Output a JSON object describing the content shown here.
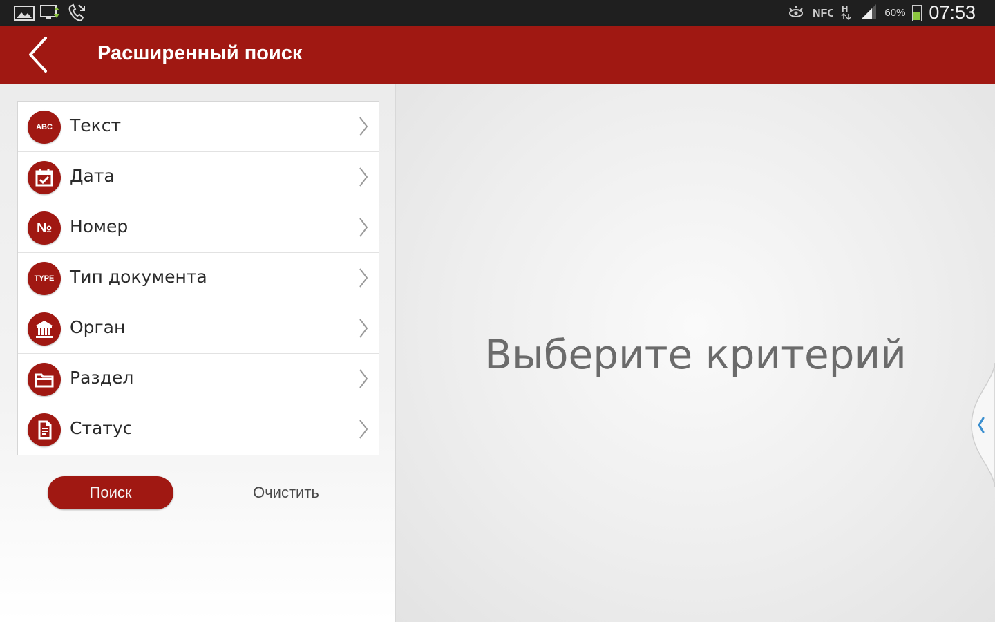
{
  "status_bar": {
    "battery_percent": "60%",
    "battery_level": 0.6,
    "time": "07:53"
  },
  "appbar": {
    "title": "Расширенный поиск"
  },
  "criteria": [
    {
      "label": "Текст",
      "icon": "abc-icon",
      "badge": "ABC"
    },
    {
      "label": "Дата",
      "icon": "calendar-icon"
    },
    {
      "label": "Номер",
      "icon": "number-icon",
      "badge": "№"
    },
    {
      "label": "Тип документа",
      "icon": "type-icon",
      "badge": "TYPE"
    },
    {
      "label": "Орган",
      "icon": "building-icon"
    },
    {
      "label": "Раздел",
      "icon": "folder-icon"
    },
    {
      "label": "Статус",
      "icon": "document-icon"
    }
  ],
  "buttons": {
    "search": "Поиск",
    "clear": "Очистить"
  },
  "detail": {
    "placeholder": "Выберите критерий"
  },
  "colors": {
    "accent": "#a01812",
    "status_bar": "#1f1f1f",
    "edge_chevron": "#3b8fcf"
  }
}
